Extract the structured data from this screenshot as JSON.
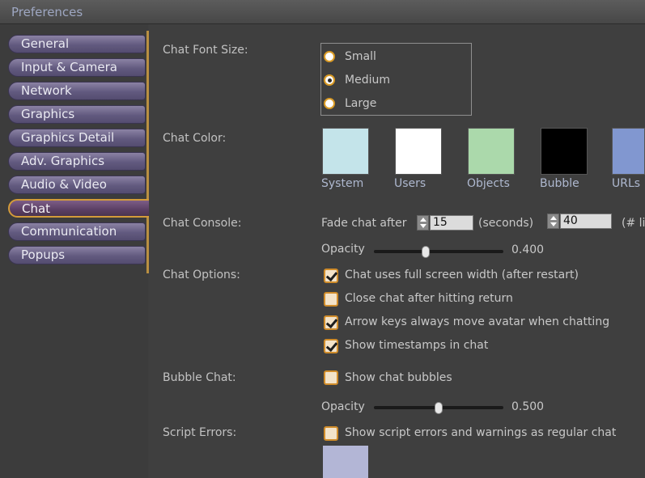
{
  "window": {
    "title": "Preferences"
  },
  "tabs": [
    {
      "label": "General",
      "selected": false
    },
    {
      "label": "Input & Camera",
      "selected": false
    },
    {
      "label": "Network",
      "selected": false
    },
    {
      "label": "Graphics",
      "selected": false
    },
    {
      "label": "Graphics Detail",
      "selected": false
    },
    {
      "label": "Adv. Graphics",
      "selected": false
    },
    {
      "label": "Audio & Video",
      "selected": false
    },
    {
      "label": "Chat",
      "selected": true
    },
    {
      "label": "Communication",
      "selected": false
    },
    {
      "label": "Popups",
      "selected": false
    }
  ],
  "chat_font_size": {
    "label": "Chat Font Size:",
    "options": [
      "Small",
      "Medium",
      "Large"
    ],
    "selected": "Medium"
  },
  "chat_color": {
    "label": "Chat Color:",
    "swatches": [
      {
        "label": "System",
        "color": "#c4e4ea"
      },
      {
        "label": "Users",
        "color": "#ffffff"
      },
      {
        "label": "Objects",
        "color": "#abd9ab"
      },
      {
        "label": "Bubble",
        "color": "#000000"
      },
      {
        "label": "URLs",
        "color": "#8197d0"
      }
    ]
  },
  "chat_console": {
    "label": "Chat Console:",
    "fade_prefix": "Fade chat after",
    "fade_value": "15",
    "fade_unit": "(seconds)",
    "lines_value": "40",
    "lines_unit": "(# li",
    "opacity_label": "Opacity",
    "opacity_value": "0.400",
    "opacity_fraction": 0.4
  },
  "chat_options": {
    "label": "Chat Options:",
    "items": [
      {
        "label": "Chat uses full screen width (after restart)",
        "checked": true
      },
      {
        "label": "Close chat after hitting return",
        "checked": false
      },
      {
        "label": "Arrow keys always move avatar when chatting",
        "checked": true
      },
      {
        "label": "Show timestamps in chat",
        "checked": true
      }
    ]
  },
  "bubble_chat": {
    "label": "Bubble Chat:",
    "checkbox_label": "Show chat bubbles",
    "checked": false,
    "opacity_label": "Opacity",
    "opacity_value": "0.500",
    "opacity_fraction": 0.5
  },
  "script_errors": {
    "label": "Script Errors:",
    "checkbox_label": "Show script errors and warnings as regular chat",
    "checked": false,
    "color": "#b3b6d6"
  },
  "colors": {
    "tab_selected_border": "#d39b3a",
    "accent_orange": "#d99a24",
    "label_blue": "#aeb8cf"
  }
}
